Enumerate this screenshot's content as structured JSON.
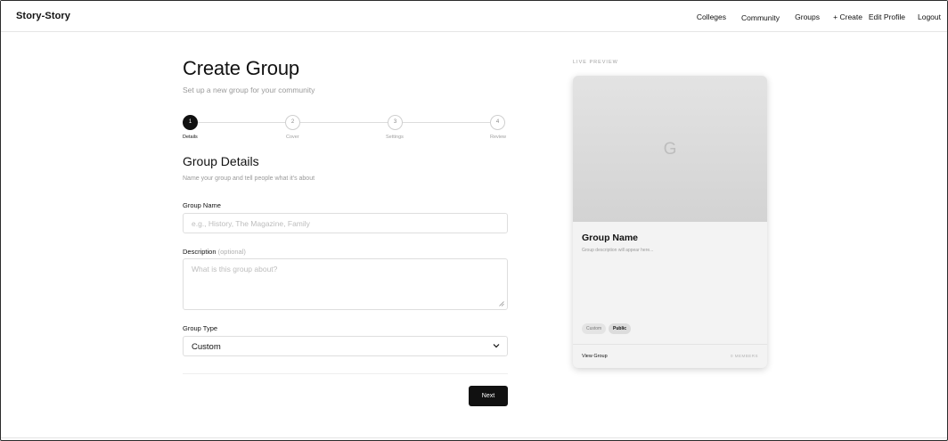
{
  "nav": {
    "brand": "Story-Story",
    "links": [
      "Colleges",
      "Community",
      "Groups",
      "+ Create",
      "Edit Profile",
      "Logout"
    ]
  },
  "page": {
    "title": "Create Group",
    "subtitle": "Set up a new group for your community"
  },
  "steps": [
    {
      "number": "1",
      "label": "Details",
      "active": true
    },
    {
      "number": "2",
      "label": "Cover",
      "active": false
    },
    {
      "number": "3",
      "label": "Settings",
      "active": false
    },
    {
      "number": "4",
      "label": "Review",
      "active": false
    }
  ],
  "section": {
    "title": "Group Details",
    "subtitle": "Name your group and tell people what it's about"
  },
  "form": {
    "name_label": "Group Name",
    "name_placeholder": "e.g., History, The Magazine, Family",
    "description_label": "Description",
    "description_optional": "(optional)",
    "description_placeholder": "What is this group about?",
    "type_label": "Group Type",
    "type_value": "Custom",
    "next_label": "Next"
  },
  "preview": {
    "label": "LIVE PREVIEW",
    "initial": "G",
    "name": "Group Name",
    "description": "Group description will appear here...",
    "tags": [
      "Custom",
      "Public"
    ],
    "view_label": "View Group",
    "members": "0 MEMBERS"
  },
  "colors": {
    "accent": "#111111",
    "muted_text": "#9a9a9a",
    "border": "#dedede"
  }
}
